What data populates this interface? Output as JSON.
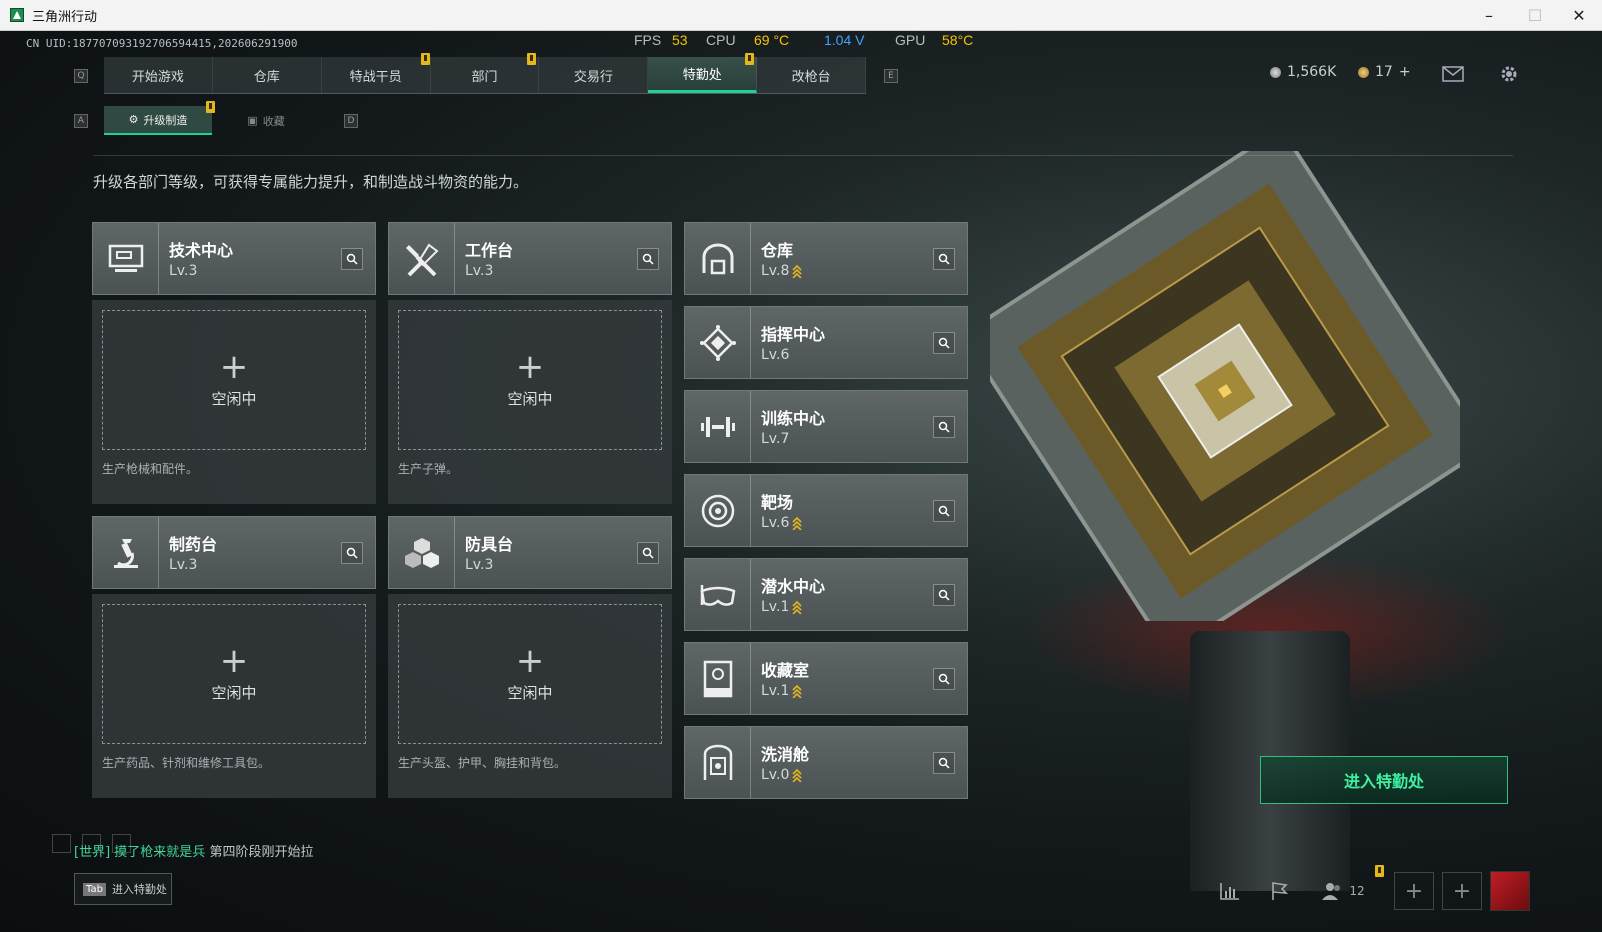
{
  "window": {
    "title": "三角洲行动",
    "controls": [
      "–",
      "☐",
      "✕"
    ]
  },
  "hud": {
    "uid": "CN UID:187707093192706594415,202606291900",
    "fps_label": "FPS",
    "fps": "53",
    "cpu_label": "CPU",
    "cpu_temp": "69 °C",
    "voltage": "1.04 V",
    "gpu_label": "GPU",
    "gpu_temp": "58°C"
  },
  "nav": {
    "key_left": "Q",
    "key_right": "E",
    "tabs": [
      "开始游戏",
      "仓库",
      "特战干员",
      "部门",
      "交易行",
      "特勤处",
      "改枪台"
    ],
    "active": "特勤处"
  },
  "currency": {
    "silver": "1,566K",
    "gold": "17",
    "gold_plus": "+"
  },
  "subnav": {
    "key_left": "A",
    "key_right": "D",
    "tabs": [
      "升级制造",
      "收藏"
    ]
  },
  "description": "升级各部门等级，可获得专属能力提升，和制造战斗物资的能力。",
  "facilities": [
    {
      "name": "技术中心",
      "level": "Lv.3",
      "desc": "生产枪械和配件。"
    },
    {
      "name": "工作台",
      "level": "Lv.3",
      "desc": "生产子弹。"
    },
    {
      "name": "制药台",
      "level": "Lv.3",
      "desc": "生产药品、针剂和维修工具包。"
    },
    {
      "name": "防具台",
      "level": "Lv.3",
      "desc": "生产头盔、护甲、胸挂和背包。"
    }
  ],
  "slot": {
    "plus": "+",
    "idle": "空闲中"
  },
  "departments": [
    {
      "name": "仓库",
      "level": "Lv.8"
    },
    {
      "name": "指挥中心",
      "level": "Lv.6"
    },
    {
      "name": "训练中心",
      "level": "Lv.7"
    },
    {
      "name": "靶场",
      "level": "Lv.6"
    },
    {
      "name": "潜水中心",
      "level": "Lv.1"
    },
    {
      "name": "收藏室",
      "level": "Lv.1"
    },
    {
      "name": "洗消舱",
      "level": "Lv.0"
    }
  ],
  "enter_button": "进入特勤处",
  "chat": {
    "channel": "[世界]",
    "user": "摸了枪来就是兵",
    "message": "第四阶段刚开始拉"
  },
  "tab_hint": {
    "key": "Tab",
    "label": "进入特勤处"
  },
  "friends_count": "12",
  "colors": {
    "accent": "#21d18f",
    "warning": "#e3b81f",
    "temp": "#f5c400",
    "voltage": "#3fa3ff"
  }
}
